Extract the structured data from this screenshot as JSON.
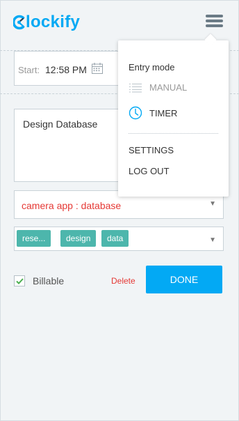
{
  "app": {
    "logo_text": "lockify",
    "brand_color": "#03a9f4"
  },
  "header": {
    "menu_icon": "hamburger-menu-icon"
  },
  "time_entry": {
    "start_label": "Start:",
    "start_time": "12:58 PM",
    "calendar_icon": "calendar-icon",
    "description": "Design Database",
    "project": "camera app : database",
    "project_color": "#e53935",
    "tags": [
      "rese...",
      "design",
      "data"
    ],
    "tag_color": "#4db6ac",
    "billable_label": "Billable",
    "billable_checked": true,
    "delete_label": "Delete",
    "done_label": "DONE"
  },
  "menu": {
    "entry_mode_title": "Entry mode",
    "manual_label": "MANUAL",
    "manual_icon": "list-icon",
    "timer_label": "TIMER",
    "timer_icon": "clock-icon",
    "settings_label": "SETTINGS",
    "logout_label": "LOG OUT"
  }
}
